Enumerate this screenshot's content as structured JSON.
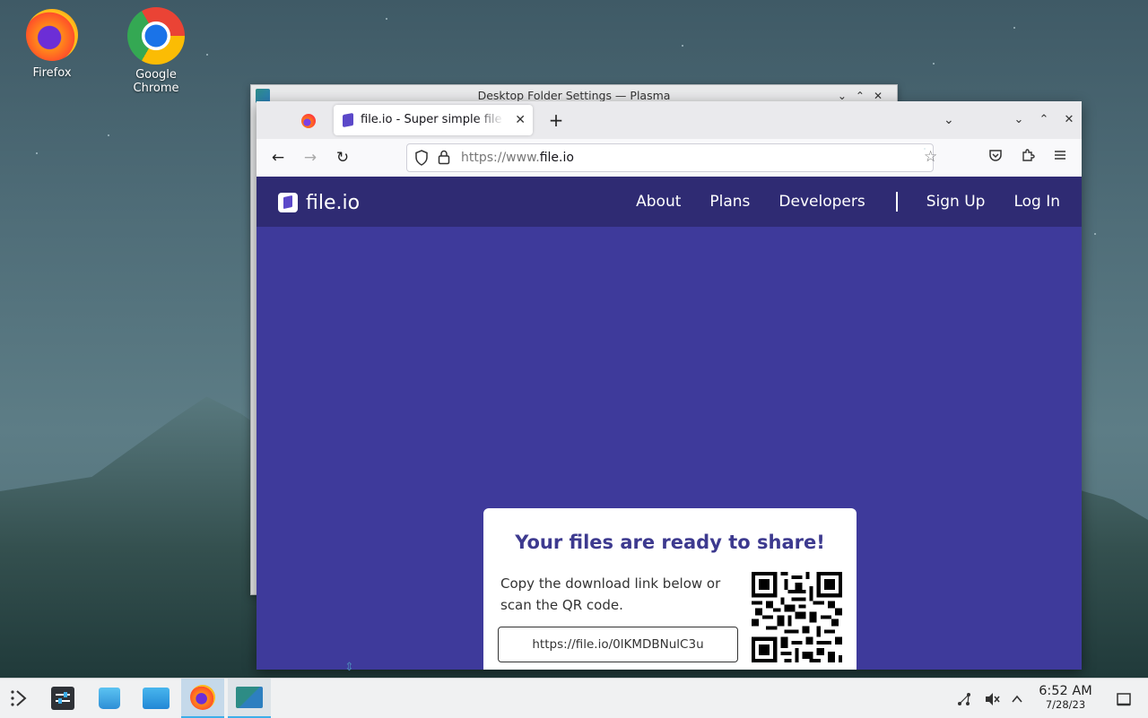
{
  "desktop": {
    "icons": [
      {
        "label": "Firefox"
      },
      {
        "label": "Google Chrome"
      }
    ]
  },
  "plasma_window": {
    "title": "Desktop Folder Settings — Plasma",
    "controls": [
      "⌄",
      "⌃",
      "✕"
    ]
  },
  "browser": {
    "tab_title": "file.io - Super simple file sharing",
    "tab_close": "✕",
    "new_tab": "+",
    "tab_list": "⌄",
    "window_controls": [
      "⌄",
      "⌃",
      "✕"
    ],
    "nav": {
      "back": "←",
      "forward": "→",
      "reload": "↻"
    },
    "url_dim": "https://www.",
    "url_host": "file.io",
    "bookmark_star": "☆",
    "toolbar_icons": [
      "pocket-icon",
      "extensions-icon",
      "menu-icon"
    ]
  },
  "site": {
    "logo_text": "file.io",
    "nav": {
      "about": "About",
      "plans": "Plans",
      "developers": "Developers",
      "signup": "Sign Up",
      "login": "Log In"
    },
    "card": {
      "heading": "Your files are ready to share!",
      "description": "Copy the download link below or scan the QR code.",
      "link": "https://file.io/0lKMDBNulC3u"
    }
  },
  "taskbar": {
    "clock_time": "6:52 AM",
    "clock_date": "7/28/23"
  },
  "colors": {
    "site_header": "#2f2b73",
    "site_body": "#3e3a9b",
    "heading": "#3d3a8f",
    "accent": "#3daee9"
  }
}
